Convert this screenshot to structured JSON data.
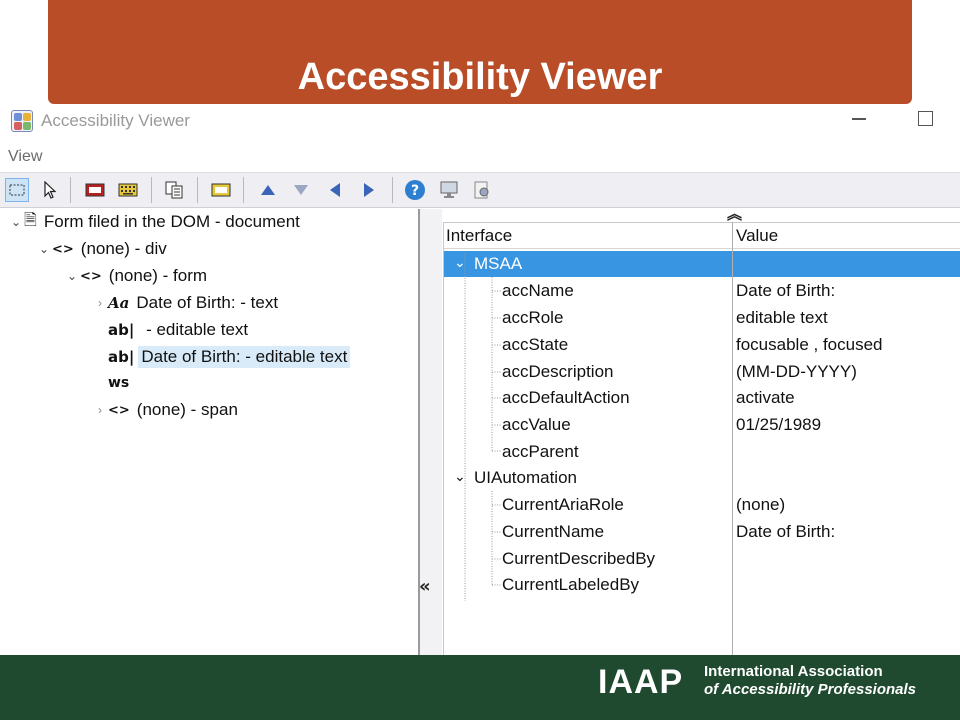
{
  "slide": {
    "title": "Accessibility Viewer"
  },
  "window": {
    "title": "Accessibility Viewer"
  },
  "menu": {
    "view": "View"
  },
  "tree": [
    {
      "label": "Form filed in the DOM - document",
      "icon": "document-icon",
      "expanded": true,
      "depth": 0,
      "glyph": "🗎"
    },
    {
      "label": "(none) - div",
      "icon": "element-icon",
      "expanded": true,
      "depth": 1,
      "glyph": "<>"
    },
    {
      "label": "(none) - form",
      "icon": "element-icon",
      "expanded": true,
      "depth": 2,
      "glyph": "<>"
    },
    {
      "label": "Date of Birth: - text",
      "icon": "text-icon",
      "expanded": false,
      "depth": 3,
      "glyph": "Aa"
    },
    {
      "label": " - editable text",
      "icon": "editable-text-icon",
      "depth": 3,
      "glyph": "ab|"
    },
    {
      "label": "Date of Birth: - editable text",
      "icon": "editable-text-icon",
      "depth": 3,
      "selected": true,
      "glyph": "ab|"
    },
    {
      "label": "",
      "icon": "whitespace-icon",
      "depth": 3,
      "glyph": "ws"
    },
    {
      "label": "(none) - span",
      "icon": "element-icon",
      "expanded": false,
      "depth": 3,
      "glyph": "<>"
    }
  ],
  "properties": {
    "headers": {
      "interface": "Interface",
      "value": "Value"
    },
    "rows": [
      {
        "name": "MSAA",
        "value": "",
        "group": true,
        "highlighted": true
      },
      {
        "name": "accName",
        "value": "Date of Birth:"
      },
      {
        "name": "accRole",
        "value": "editable text"
      },
      {
        "name": "accState",
        "value": "focusable , focused"
      },
      {
        "name": "accDescription",
        "value": "(MM-DD-YYYY)"
      },
      {
        "name": "accDefaultAction",
        "value": "activate"
      },
      {
        "name": "accValue",
        "value": "01/25/1989"
      },
      {
        "name": "accParent",
        "value": ""
      },
      {
        "name": "UIAutomation",
        "value": "",
        "group": true
      },
      {
        "name": "CurrentAriaRole",
        "value": "(none)"
      },
      {
        "name": "CurrentName",
        "value": "Date of Birth:"
      },
      {
        "name": "CurrentDescribedBy",
        "value": ""
      },
      {
        "name": "CurrentLabeledBy",
        "value": ""
      }
    ]
  },
  "footer": {
    "logo": "IAAP",
    "org_line1": "International Association",
    "org_line2": "of Accessibility Professionals"
  },
  "colors": {
    "banner": "#b84d28",
    "footer": "#1f4a2f",
    "selection": "#3795e2",
    "tree_selection": "#d9ebf9"
  }
}
